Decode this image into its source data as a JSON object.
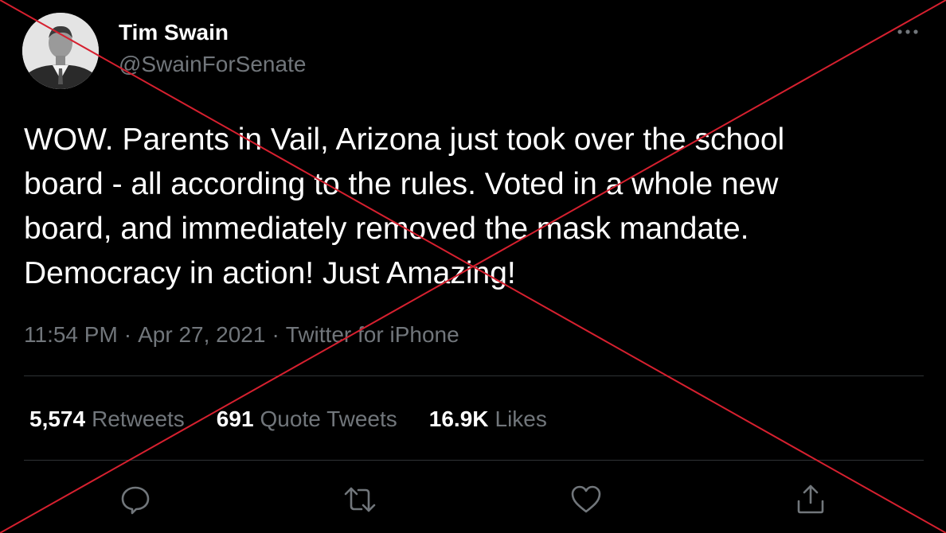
{
  "tweet": {
    "author_name": "Tim Swain",
    "author_handle": "@SwainForSenate",
    "text": "WOW. Parents in Vail, Arizona just took over the school\nboard - all according to the rules.  Voted in a whole new\nboard, and immediately removed the mask mandate.\nDemocracy in action! Just Amazing!",
    "time": "11:54 PM",
    "date": "Apr 27, 2021",
    "source": "Twitter for iPhone",
    "separator": "·"
  },
  "stats": {
    "retweets_count": "5,574",
    "retweets_label": "Retweets",
    "quotes_count": "691",
    "quotes_label": "Quote Tweets",
    "likes_count": "16.9K",
    "likes_label": "Likes"
  },
  "icons": {
    "more": "more-icon",
    "reply": "reply-icon",
    "retweet": "retweet-icon",
    "like": "heart-icon",
    "share": "share-icon"
  },
  "colors": {
    "background": "#000000",
    "text_primary": "#ffffff",
    "text_secondary": "#71767b",
    "divider": "#2f3336",
    "cross_overlay": "#d6202f"
  }
}
